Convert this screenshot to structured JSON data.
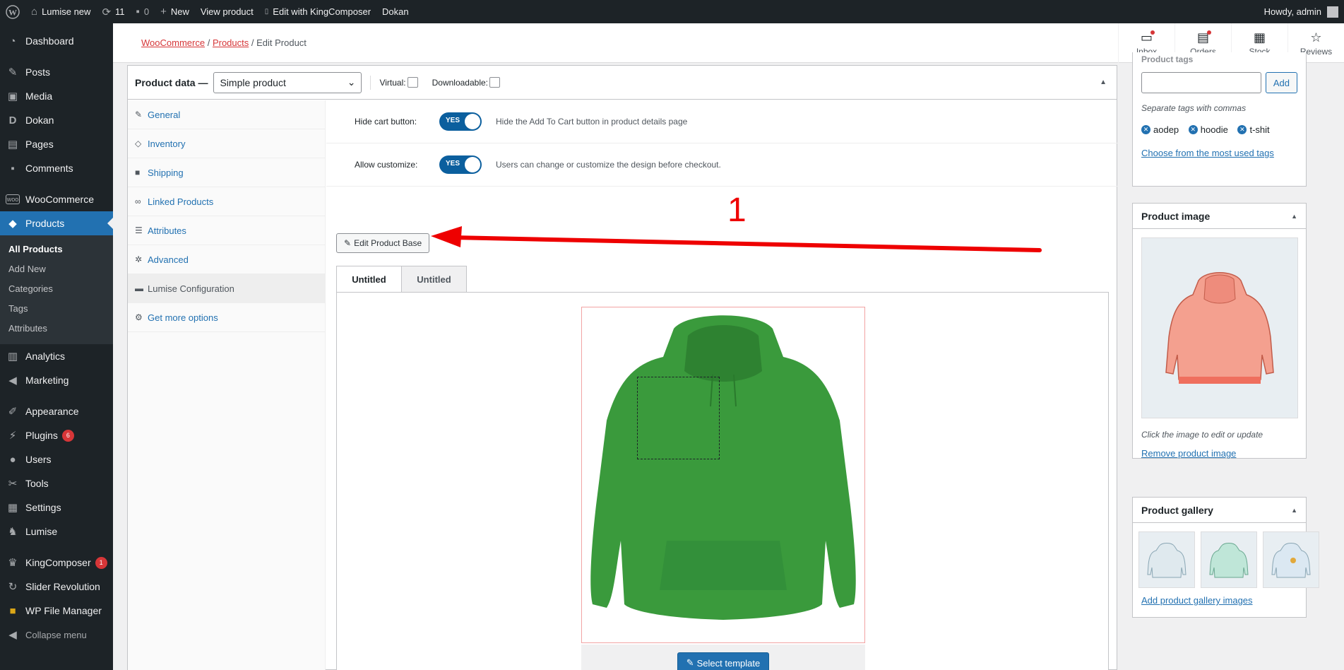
{
  "adminbar": {
    "site_name": "Lumise new",
    "updates_count": "11",
    "comments_count": "0",
    "new_label": "New",
    "view_product": "View product",
    "edit_kingcomposer": "Edit with KingComposer",
    "dokan": "Dokan",
    "howdy": "Howdy, admin"
  },
  "sidebar": {
    "items": [
      {
        "label": "Dashboard",
        "icon": "dashboard-icon"
      },
      {
        "label": "Posts",
        "icon": "pin-icon"
      },
      {
        "label": "Media",
        "icon": "media-icon"
      },
      {
        "label": "Dokan",
        "icon": "dokan-icon"
      },
      {
        "label": "Pages",
        "icon": "pages-icon"
      },
      {
        "label": "Comments",
        "icon": "comment-icon"
      },
      {
        "label": "WooCommerce",
        "icon": "woo-icon"
      },
      {
        "label": "Products",
        "icon": "box-icon"
      },
      {
        "label": "Analytics",
        "icon": "chart-icon"
      },
      {
        "label": "Marketing",
        "icon": "megaphone-icon"
      },
      {
        "label": "Appearance",
        "icon": "brush-icon"
      },
      {
        "label": "Plugins",
        "icon": "plug-icon",
        "badge": "6"
      },
      {
        "label": "Users",
        "icon": "user-icon"
      },
      {
        "label": "Tools",
        "icon": "wrench-icon"
      },
      {
        "label": "Settings",
        "icon": "settings-icon"
      },
      {
        "label": "Lumise",
        "icon": "lumise-icon"
      },
      {
        "label": "KingComposer",
        "icon": "crown-icon",
        "badge": "1"
      },
      {
        "label": "Slider Revolution",
        "icon": "refresh-icon"
      },
      {
        "label": "WP File Manager",
        "icon": "folder-icon"
      },
      {
        "label": "Collapse menu",
        "icon": "collapse-icon"
      }
    ],
    "submenu": [
      "All Products",
      "Add New",
      "Categories",
      "Tags",
      "Attributes"
    ]
  },
  "header": {
    "breadcrumb_woo": "WooCommerce",
    "breadcrumb_products": "Products",
    "breadcrumb_current": "/ Edit Product",
    "sep": "/",
    "actions": [
      "Inbox",
      "Orders",
      "Stock",
      "Reviews"
    ]
  },
  "product_data": {
    "title": "Product data —",
    "type_value": "Simple product",
    "virtual_label": "Virtual:",
    "downloadable_label": "Downloadable:",
    "tabs": [
      "General",
      "Inventory",
      "Shipping",
      "Linked Products",
      "Attributes",
      "Advanced",
      "Lumise Configuration",
      "Get more options"
    ],
    "hide_cart_label": "Hide cart button:",
    "hide_cart_toggle": "YES",
    "hide_cart_desc": "Hide the Add To Cart button in product details page",
    "allow_customize_label": "Allow customize:",
    "allow_customize_toggle": "YES",
    "allow_customize_desc": "Users can change or customize the design before checkout.",
    "edit_base_button": "Edit Product Base",
    "annotation_number": "1",
    "stage_tabs": [
      "Untitled",
      "Untitled"
    ],
    "select_template_button": "Select template"
  },
  "product_tags": {
    "title": "Product tags",
    "add_button": "Add",
    "hint": "Separate tags with commas",
    "tags": [
      "aodep",
      "hoodie",
      "t-shit"
    ],
    "choose_link": "Choose from the most used tags"
  },
  "product_image": {
    "title": "Product image",
    "hint": "Click the image to edit or update",
    "remove_link": "Remove product image"
  },
  "product_gallery": {
    "title": "Product gallery",
    "add_link": "Add product gallery images"
  },
  "colors": {
    "accent": "#2271b1",
    "hoodie_green": "#3a9a3c",
    "hoodie_pink": "#f4a08f",
    "arrow_red": "#ee0000"
  }
}
